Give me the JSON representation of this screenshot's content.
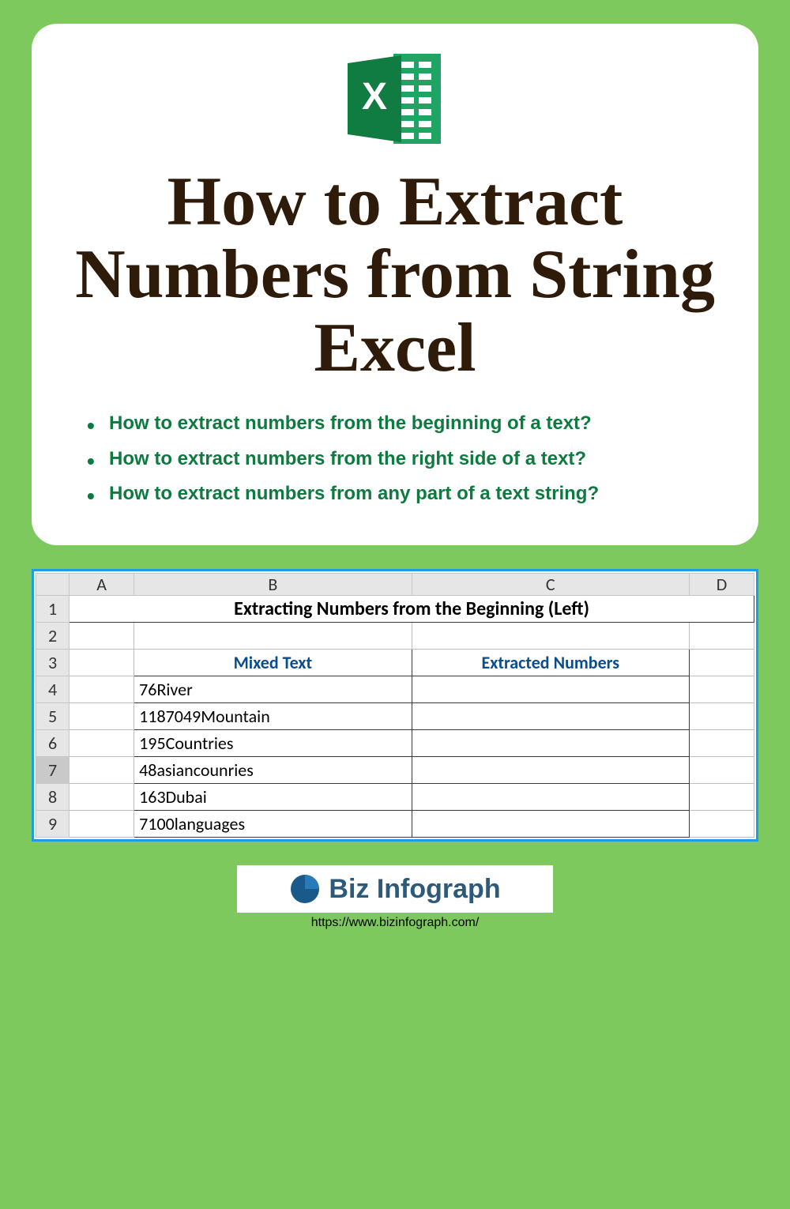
{
  "title": "How to Extract Numbers from String Excel",
  "bullets": [
    "How to extract numbers from the beginning of a text?",
    "How to extract numbers from the right side of a text?",
    "How to extract numbers from any part of a text string?"
  ],
  "spreadsheet": {
    "columns": [
      "A",
      "B",
      "C",
      "D"
    ],
    "rows": [
      "1",
      "2",
      "3",
      "4",
      "5",
      "6",
      "7",
      "8",
      "9"
    ],
    "selected_row": "7",
    "merged_title": "Extracting Numbers from the Beginning (Left)",
    "header_b": "Mixed Text",
    "header_c": "Extracted Numbers",
    "data": [
      "76River",
      "1187049Mountain",
      "195Countries",
      "48asiancounries",
      "163Dubai",
      "7100languages"
    ]
  },
  "logo": {
    "name": "Biz Infograph",
    "url": "https://www.bizinfograph.com/"
  }
}
